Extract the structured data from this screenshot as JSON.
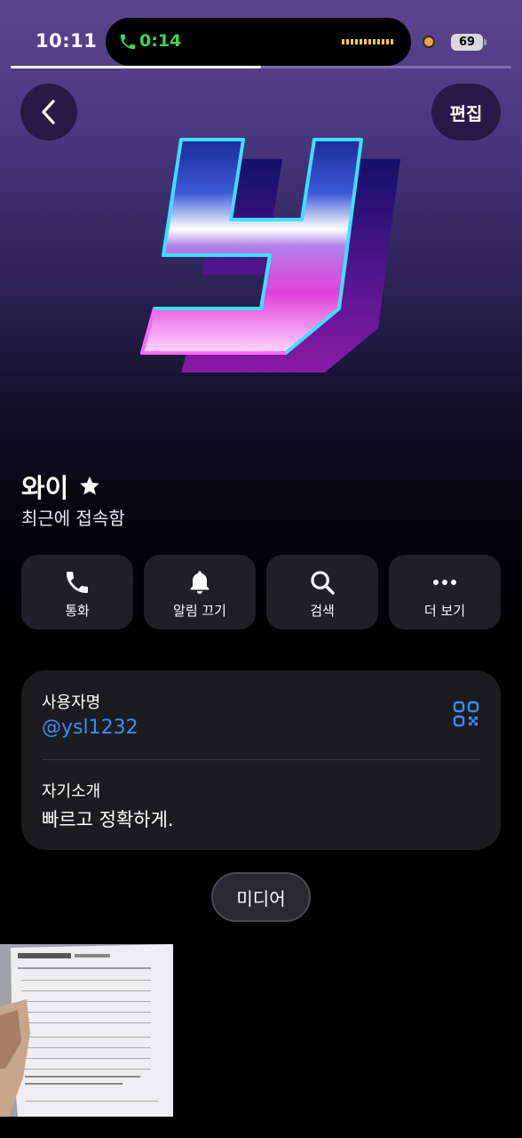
{
  "status_bar": {
    "time": "10:11",
    "call_duration": "0:14",
    "battery": "69",
    "video_progress_fraction": 0.5
  },
  "header": {
    "edit_label": "편집"
  },
  "profile": {
    "name": "와이",
    "status": "최근에 접속함"
  },
  "actions": [
    {
      "label": "통화",
      "icon": "phone-icon"
    },
    {
      "label": "알림 끄기",
      "icon": "bell-icon"
    },
    {
      "label": "검색",
      "icon": "search-icon"
    },
    {
      "label": "더 보기",
      "icon": "more-icon"
    }
  ],
  "info": {
    "username_label": "사용자명",
    "username": "@ysl1232",
    "bio_label": "자기소개",
    "bio": "빠르고 정확하게."
  },
  "media": {
    "tab_label": "미디어"
  },
  "colors": {
    "accent_link": "#3b8cf5",
    "call_green": "#3fd356",
    "card_bg": "#1c1c1f"
  }
}
